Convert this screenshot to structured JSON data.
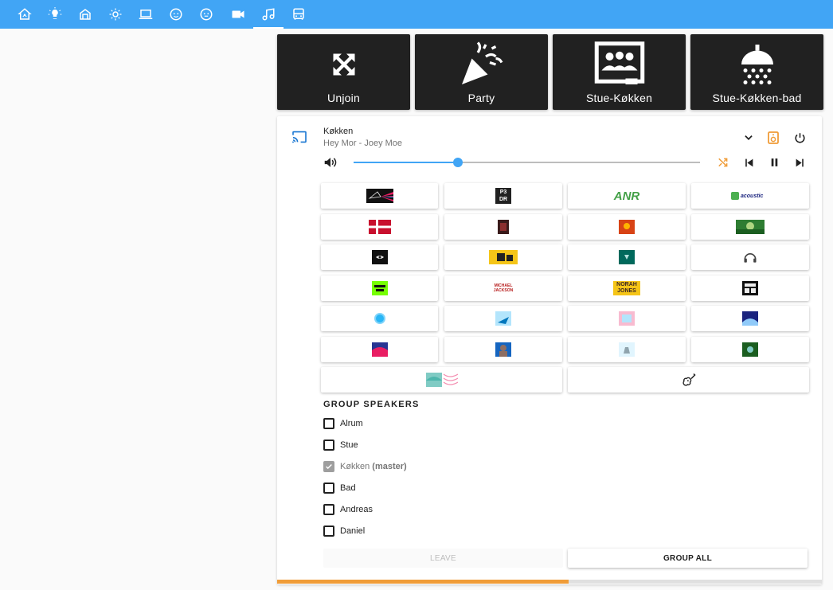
{
  "nav": {
    "tabs": [
      {
        "icon": "home-assistant-icon"
      },
      {
        "icon": "lightbulb-icon"
      },
      {
        "icon": "home-outline-icon"
      },
      {
        "icon": "brightness-icon"
      },
      {
        "icon": "laptop-icon"
      },
      {
        "icon": "baby-face-icon"
      },
      {
        "icon": "baby-face-outline-icon"
      },
      {
        "icon": "video-icon"
      },
      {
        "icon": "music-icon",
        "active": true
      },
      {
        "icon": "bus-icon"
      }
    ]
  },
  "scenes": [
    {
      "label": "Unjoin",
      "icon": "arrow-split-icon"
    },
    {
      "label": "Party",
      "icon": "party-popper-icon"
    },
    {
      "label": "Stue-Køkken",
      "icon": "presentation-group-icon"
    },
    {
      "label": "Stue-Køkken-bad",
      "icon": "shower-icon"
    }
  ],
  "player": {
    "name": "Køkken",
    "now_playing": "Hey Mor - Joey Moe",
    "volume_percent": 30,
    "accent_color": "#41a5f5",
    "shuffle_color": "#f09c38"
  },
  "favorites": [
    {
      "id": "fav-prism",
      "colors": [
        "#1a1a1a",
        "#e91e63",
        "#2196f3"
      ]
    },
    {
      "id": "fav-p3-dr",
      "text": "P3 DR"
    },
    {
      "id": "fav-anr",
      "text": "ANR"
    },
    {
      "id": "fav-acoustic",
      "text": "acoustic"
    },
    {
      "id": "fav-danish-flag",
      "colors": [
        "#c8102e",
        "#ffffff"
      ]
    },
    {
      "id": "fav-album-dark-red",
      "colors": [
        "#3a1a1a",
        "#8b2e2e"
      ]
    },
    {
      "id": "fav-album-red-gold",
      "colors": [
        "#d84315",
        "#ffb300"
      ]
    },
    {
      "id": "fav-album-green",
      "colors": [
        "#2e7d32",
        "#aed581"
      ]
    },
    {
      "id": "fav-album-eye",
      "colors": [
        "#111111",
        "#eeeeee"
      ]
    },
    {
      "id": "fav-album-yellow-black",
      "colors": [
        "#f5c518",
        "#222222"
      ]
    },
    {
      "id": "fav-album-teal",
      "colors": [
        "#00695c",
        "#b2dfdb"
      ]
    },
    {
      "id": "fav-headphones",
      "colors": [
        "#424242",
        "#ffffff"
      ]
    },
    {
      "id": "fav-album-neon",
      "colors": [
        "#76ff03",
        "#111111"
      ]
    },
    {
      "id": "fav-michael-jackson",
      "text": "MICHAEL JACKSON"
    },
    {
      "id": "fav-norah-jones",
      "text": "NORAH JONES"
    },
    {
      "id": "fav-album-bw",
      "colors": [
        "#111111",
        "#eeeeee"
      ]
    },
    {
      "id": "fav-album-sky",
      "colors": [
        "#81d4fa",
        "#29b6f6"
      ]
    },
    {
      "id": "fav-album-bird",
      "colors": [
        "#b3e5fc",
        "#0277bd"
      ]
    },
    {
      "id": "fav-album-pastel",
      "colors": [
        "#f8bbd0",
        "#b3e5fc"
      ]
    },
    {
      "id": "fav-album-navy",
      "colors": [
        "#1a237e",
        "#90caf9"
      ]
    },
    {
      "id": "fav-album-sunset",
      "colors": [
        "#e91e63",
        "#283593"
      ]
    },
    {
      "id": "fav-album-portrait",
      "colors": [
        "#8d6e63",
        "#1565c0"
      ]
    },
    {
      "id": "fav-album-light",
      "colors": [
        "#e1f5fe",
        "#90a4ae"
      ]
    },
    {
      "id": "fav-album-forest",
      "colors": [
        "#1b5e20",
        "#80cbc4"
      ]
    },
    {
      "id": "fav-playlist-waves",
      "colors": [
        "#80cbc4",
        "#f48fb1"
      ]
    },
    {
      "id": "fav-guitar",
      "icon": "guitar-icon"
    }
  ],
  "group": {
    "heading": "GROUP SPEAKERS",
    "speakers": [
      {
        "label": "Alrum",
        "checked": false
      },
      {
        "label": "Stue",
        "checked": false
      },
      {
        "label": "Køkken",
        "checked": true,
        "master_label": "(master)"
      },
      {
        "label": "Bad",
        "checked": false
      },
      {
        "label": "Andreas",
        "checked": false
      },
      {
        "label": "Daniel",
        "checked": false
      }
    ],
    "leave_label": "LEAVE",
    "group_all_label": "GROUP ALL"
  }
}
